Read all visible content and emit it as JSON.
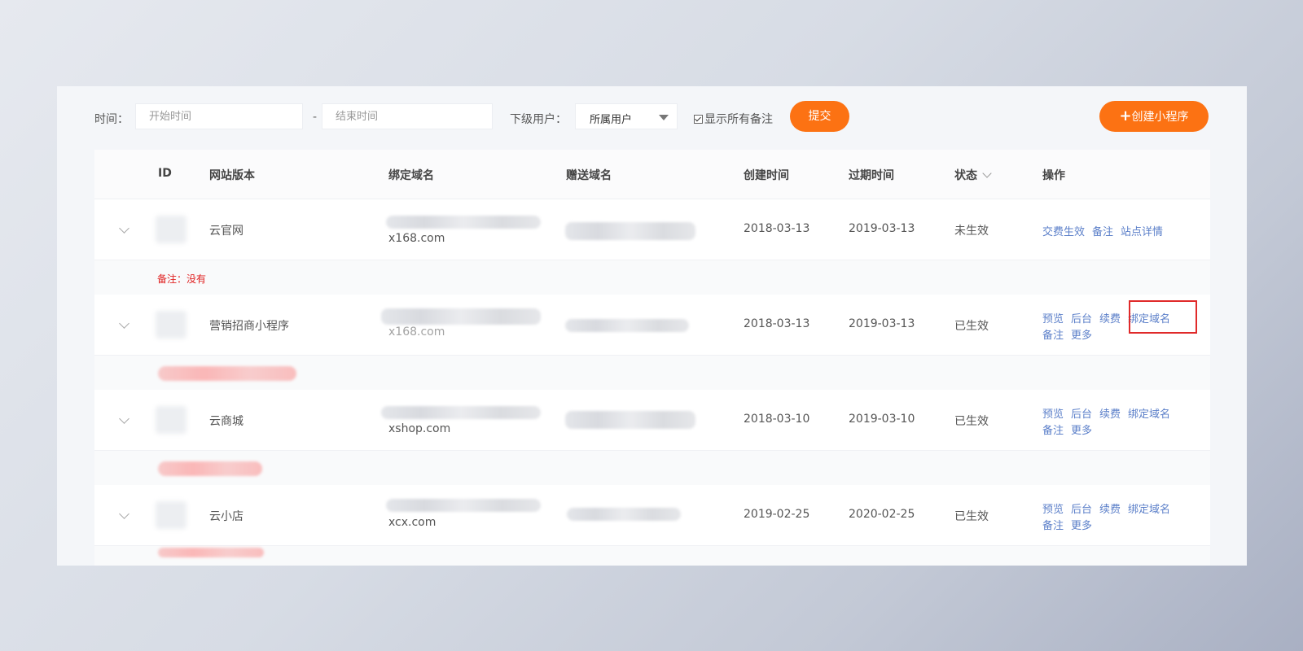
{
  "toolbar": {
    "time_label": "时间：",
    "start_placeholder": "开始时间",
    "dash": "-",
    "end_placeholder": "结束时间",
    "sub_user_label": "下级用户：",
    "sub_user_value": "所属用户",
    "show_notes_label": "显示所有备注",
    "show_notes_checked": true,
    "submit_label": "提交",
    "create_label": "创建小程序",
    "create_icon": "plus-icon"
  },
  "columns": [
    "ID",
    "网站版本",
    "绑定域名",
    "赠送域名",
    "创建时间",
    "过期时间",
    "状态",
    "操作"
  ],
  "rows": [
    {
      "version": "云官网",
      "bound_domain": "x168.com",
      "created": "2018-03-13",
      "expires": "2019-03-13",
      "status": "未生效",
      "actions_line1": [
        "交费生效",
        "备注",
        "站点详情"
      ],
      "actions_line2": [],
      "note": "备注：没有"
    },
    {
      "version": "营销招商小程序",
      "bound_domain": "x168.com",
      "created": "2018-03-13",
      "expires": "2019-03-13",
      "status": "已生效",
      "actions_line1": [
        "预览",
        "后台",
        "续费",
        "绑定域名"
      ],
      "actions_line2": [
        "备注",
        "更多"
      ],
      "note": ""
    },
    {
      "version": "云商城",
      "bound_domain": "xshop.com",
      "created": "2018-03-10",
      "expires": "2019-03-10",
      "status": "已生效",
      "actions_line1": [
        "预览",
        "后台",
        "续费",
        "绑定域名"
      ],
      "actions_line2": [
        "备注",
        "更多"
      ],
      "note": ""
    },
    {
      "version": "云小店",
      "bound_domain": "xcx.com",
      "created": "2019-02-25",
      "expires": "2020-02-25",
      "status": "已生效",
      "actions_line1": [
        "预览",
        "后台",
        "续费",
        "绑定域名"
      ],
      "actions_line2": [
        "备注",
        "更多"
      ],
      "note": ""
    }
  ],
  "colors": {
    "accent_orange": "#fc7213",
    "link_blue": "#5b7fc9",
    "note_red": "#e02020",
    "highlight_red": "#e02a2a"
  }
}
